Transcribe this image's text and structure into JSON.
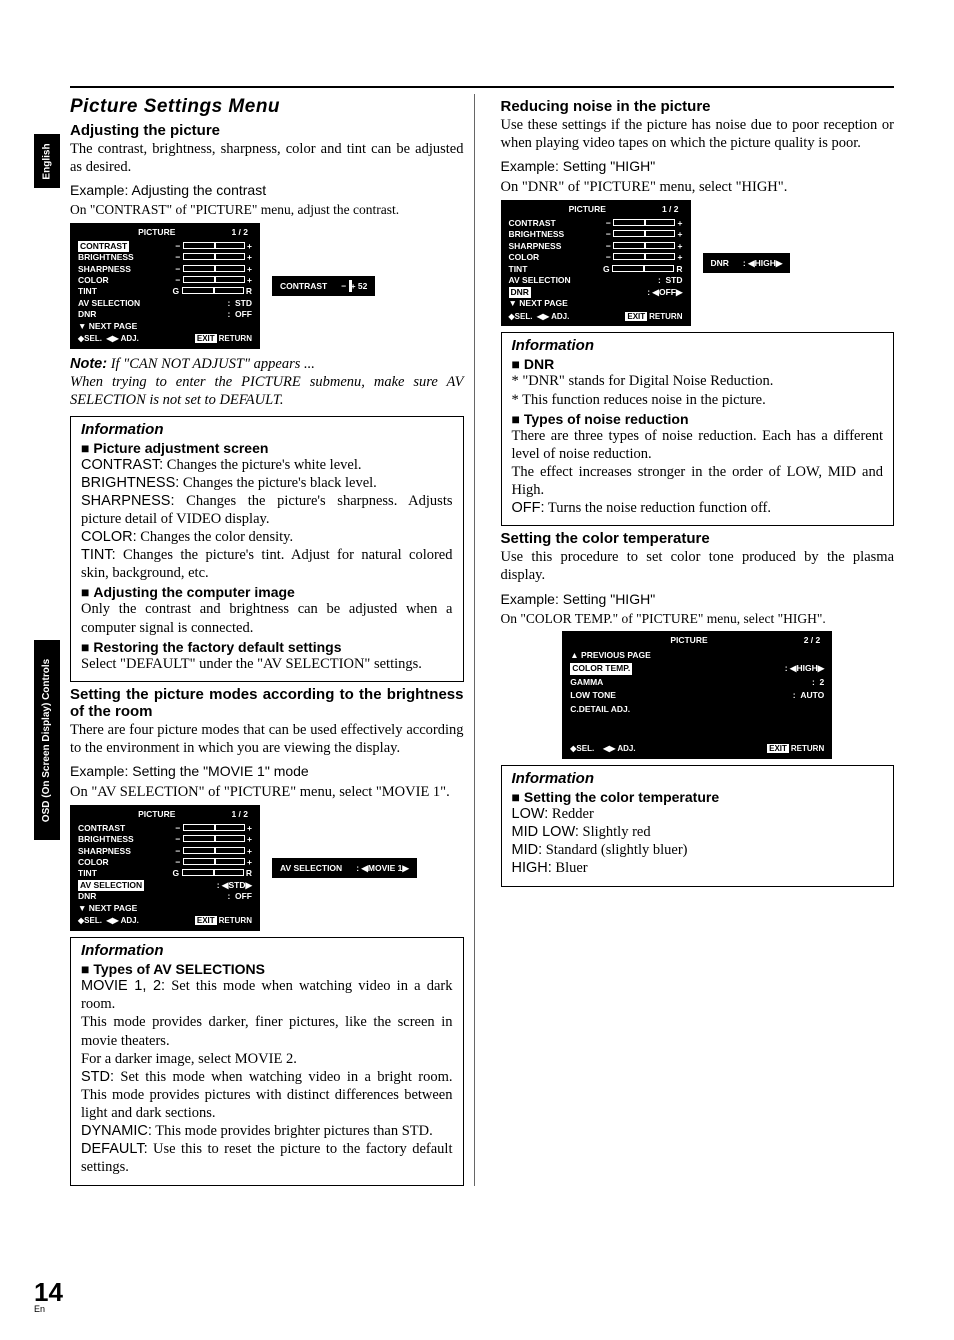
{
  "sidetab1": "English",
  "sidetab2": "OSD (On Screen Display) Controls",
  "page_number": "14",
  "page_lang": "En",
  "left": {
    "title": "Picture Settings Menu",
    "h_adjust": "Adjusting the picture",
    "adjust_body": "The contrast, brightness, sharpness, color and tint can be adjusted as desired.",
    "eg1": "Example: Adjusting the contrast",
    "eg1_body": "On \"CONTRAST\" of \"PICTURE\" menu, adjust the contrast.",
    "osd1": {
      "title": "PICTURE",
      "page": "1 / 2",
      "rows": [
        "CONTRAST",
        "BRIGHTNESS",
        "SHARPNESS",
        "COLOR",
        "TINT"
      ],
      "avsel_label": "AV SELECTION",
      "avsel_val": "STD",
      "dnr_label": "DNR",
      "dnr_val": "OFF",
      "next": "NEXT PAGE",
      "sel": "SEL.",
      "adj": "ADJ.",
      "return": "RETURN",
      "exit": "EXIT"
    },
    "strip1_label": "CONTRAST",
    "strip1_val": "52",
    "note_label": "Note:",
    "note_lead": "If \"CAN NOT ADJUST\" appears ...",
    "note_body": "When trying to enter the PICTURE submenu, make sure AV SELECTION is not set to DEFAULT.",
    "info1_title": "Information",
    "info1_h": "Picture adjustment screen",
    "info1_lines": [
      {
        "lead": "CONTRAST:",
        "rest": " Changes the picture's white level."
      },
      {
        "lead": "BRIGHTNESS:",
        "rest": " Changes the picture's black level."
      },
      {
        "lead": "SHARPNESS:",
        "rest": " Changes the picture's sharpness. Adjusts picture detail of VIDEO display."
      },
      {
        "lead": "COLOR:",
        "rest": " Changes the color density."
      },
      {
        "lead": "TINT:",
        "rest": " Changes the picture's tint. Adjust for natural colored skin, background, etc."
      }
    ],
    "info1_h2": "Adjusting the computer image",
    "info1_h2_body": "Only the contrast and brightness can be adjusted when a computer signal is connected.",
    "info1_h3": "Restoring the factory default settings",
    "info1_h3_body": "Select \"DEFAULT\" under the \"AV SELECTION\" settings.",
    "h_modes": "Setting the picture modes according to the brightness of the room",
    "modes_body": "There are four picture modes that can be used effectively according to the environment in which you are viewing the display.",
    "eg2": "Example: Setting the \"MOVIE 1\" mode",
    "eg2_body": "On \"AV SELECTION\" of \"PICTURE\" menu, select \"MOVIE 1\".",
    "osd2": {
      "title": "PICTURE",
      "page": "1 / 2",
      "rows": [
        "CONTRAST",
        "BRIGHTNESS",
        "SHARPNESS",
        "COLOR",
        "TINT"
      ],
      "avsel_label": "AV SELECTION",
      "avsel_val": "STD",
      "dnr_label": "DNR",
      "dnr_val": "OFF",
      "next": "NEXT PAGE",
      "sel": "SEL.",
      "adj": "ADJ.",
      "return": "RETURN",
      "exit": "EXIT"
    },
    "strip2_label": "AV SELECTION",
    "strip2_val": "MOVIE 1",
    "info2_title": "Information",
    "info2_h": "Types of AV SELECTIONS",
    "info2_lines": [
      {
        "lead": "MOVIE 1, 2:",
        "rest": " Set this mode when watching video in a dark room."
      },
      {
        "lead": "",
        "rest": "This mode provides darker, finer pictures, like the screen in movie theaters."
      },
      {
        "lead": "",
        "rest": "For a darker image, select MOVIE 2."
      },
      {
        "lead": "STD:",
        "rest": " Set this mode when watching video in a bright room. This mode provides pictures with distinct differences between light and dark sections."
      },
      {
        "lead": "DYNAMIC:",
        "rest": " This mode provides brighter pictures than STD."
      },
      {
        "lead": "DEFAULT:",
        "rest": " Use this to reset the picture to the factory default settings."
      }
    ]
  },
  "right": {
    "h_noise": "Reducing noise in the picture",
    "noise_body": "Use these settings if the picture has noise due to poor reception or when playing video tapes on which the picture quality is poor.",
    "eg3": "Example: Setting \"HIGH\"",
    "eg3_body": "On \"DNR\" of \"PICTURE\" menu, select \"HIGH\".",
    "osd3": {
      "title": "PICTURE",
      "page": "1 / 2",
      "rows": [
        "CONTRAST",
        "BRIGHTNESS",
        "SHARPNESS",
        "COLOR",
        "TINT"
      ],
      "avsel_label": "AV SELECTION",
      "avsel_val": "STD",
      "dnr_label": "DNR",
      "dnr_val": "OFF",
      "next": "NEXT PAGE",
      "sel": "SEL.",
      "adj": "ADJ.",
      "return": "RETURN",
      "exit": "EXIT"
    },
    "strip3_label": "DNR",
    "strip3_val": "HIGH",
    "info3_title": "Information",
    "info3_h": "DNR",
    "info3_lines": [
      "* \"DNR\" stands for Digital Noise Reduction.",
      "* This function reduces noise in the picture."
    ],
    "info3_h2": "Types of noise reduction",
    "info3_h2_body1": "There are three types of noise reduction. Each has a different level of noise reduction.",
    "info3_h2_body2": "The effect increases stronger in the order of LOW, MID and High.",
    "info3_off_lead": "OFF:",
    "info3_off_rest": " Turns the noise reduction function off.",
    "h_color": "Setting the color temperature",
    "color_body": "Use this procedure to set color tone produced by the plasma display.",
    "eg4": "Example: Setting \"HIGH\"",
    "eg4_body": "On \"COLOR TEMP.\" of \"PICTURE\" menu, select \"HIGH\".",
    "osd4": {
      "title": "PICTURE",
      "page": "2 / 2",
      "prev": "PREVIOUS PAGE",
      "ct_label": "COLOR TEMP.",
      "ct_val": "HIGH",
      "gamma_label": "GAMMA",
      "gamma_val": "2",
      "lowtone_label": "LOW TONE",
      "lowtone_val": "AUTO",
      "cdetail": "C.DETAIL ADJ.",
      "sel": "SEL.",
      "adj": "ADJ.",
      "return": "RETURN",
      "exit": "EXIT"
    },
    "info4_title": "Information",
    "info4_h": "Setting the color temperature",
    "info4_lines": [
      {
        "lead": "LOW:",
        "rest": " Redder"
      },
      {
        "lead": "MID LOW:",
        "rest": " Slightly red"
      },
      {
        "lead": "MID:",
        "rest": " Standard (slightly bluer)"
      },
      {
        "lead": "HIGH:",
        "rest": " Bluer"
      }
    ]
  }
}
